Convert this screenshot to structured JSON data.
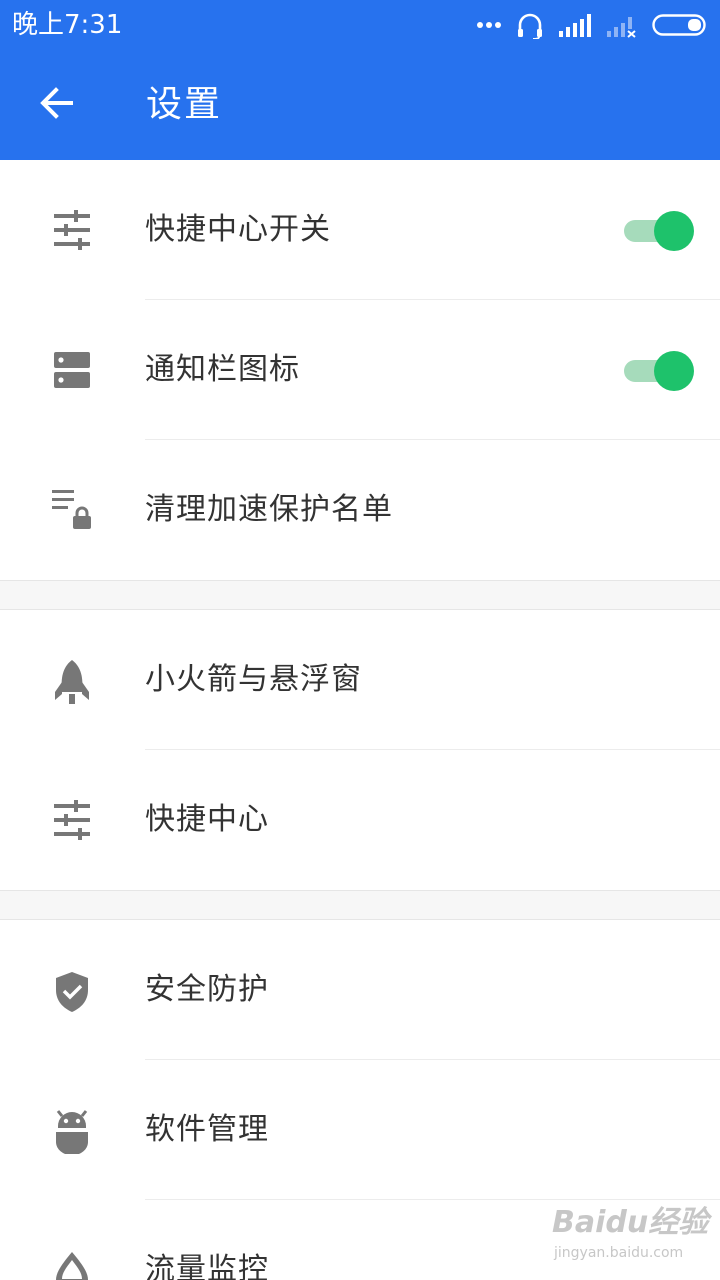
{
  "status_bar": {
    "time": "晚上7:31",
    "icons": [
      "more-dots-icon",
      "headset-icon",
      "signal-icon",
      "signal-off-icon",
      "battery-icon"
    ]
  },
  "app_bar": {
    "title": "设置",
    "back_icon": "arrow-left-icon",
    "background": "#2772ee"
  },
  "sections": [
    {
      "items": [
        {
          "label": "快捷中心开关",
          "icon": "sliders-icon",
          "toggle": true,
          "enabled": true
        },
        {
          "label": "通知栏图标",
          "icon": "server-icon",
          "toggle": true,
          "enabled": true
        },
        {
          "label": "清理加速保护名单",
          "icon": "list-lock-icon"
        }
      ]
    },
    {
      "items": [
        {
          "label": "小火箭与悬浮窗",
          "icon": "rocket-icon"
        },
        {
          "label": "快捷中心",
          "icon": "sliders-icon"
        }
      ]
    },
    {
      "items": [
        {
          "label": "安全防护",
          "icon": "shield-check-icon"
        },
        {
          "label": "软件管理",
          "icon": "android-icon"
        },
        {
          "label": "流量监控",
          "icon": "drop-icon"
        }
      ]
    }
  ],
  "toggle_colors": {
    "on_knob": "#1ec26b",
    "on_track": "#a6dbbb"
  },
  "watermark": {
    "brand": "Baidu经验",
    "url": "jingyan.baidu.com"
  }
}
